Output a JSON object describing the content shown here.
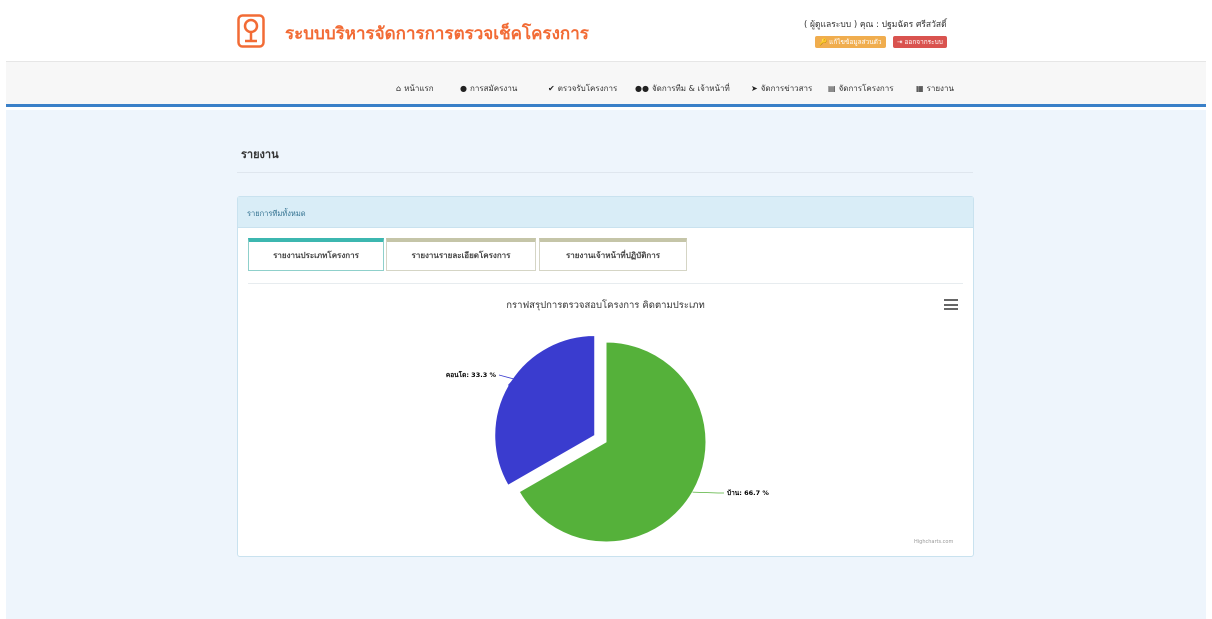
{
  "header": {
    "app_title": "ระบบบริหารจัดการการตรวจเช็คโครงการ",
    "user_line": "( ผู้ดูแลระบบ ) คุณ : ปฐมฉัตร ศรีสวัสดิ์",
    "profile_button": "🔑 แก้ไขข้อมูลส่วนตัว",
    "logout_button": "⇥ ออกจากระบบ"
  },
  "nav": {
    "items": [
      {
        "icon": "home-icon",
        "glyph": "⌂",
        "label": "หน้าแรก"
      },
      {
        "icon": "user-icon",
        "glyph": "👤",
        "label": "การสมัครงาน"
      },
      {
        "icon": "check-icon",
        "glyph": "✔",
        "label": "ตรวจรับโครงการ"
      },
      {
        "icon": "users-icon",
        "glyph": "👥",
        "label": "จัดการทีม & เจ้าหน้าที่"
      },
      {
        "icon": "send-icon",
        "glyph": "➤",
        "label": "จัดการข่าวสาร"
      },
      {
        "icon": "file-icon",
        "glyph": "▤",
        "label": "จัดการโครงการ"
      },
      {
        "icon": "chart-icon",
        "glyph": "▦",
        "label": "รายงาน"
      }
    ]
  },
  "page": {
    "title": "รายงาน",
    "panel_heading": "รายการทีมทั้งหมด"
  },
  "tabs": [
    {
      "label": "รายงานประเภทโครงการ",
      "active": true
    },
    {
      "label": "รายงานรายละเอียดโครงการ",
      "active": false
    },
    {
      "label": "รายงานเจ้าหน้าที่ปฏิบัติการ",
      "active": false
    }
  ],
  "chart_data": {
    "type": "pie",
    "title": "กราฟสรุปการตรวจสอบโครงการ คิดตามประเภท",
    "slices": [
      {
        "name": "บ้าน",
        "value": 66.7,
        "label": "บ้าน: 66.7 %",
        "color": "#55b13a"
      },
      {
        "name": "คอนโด",
        "value": 33.3,
        "label": "คอนโด: 33.3 %",
        "color": "#3a3ccf",
        "sliced": true
      }
    ],
    "credits": "Highcharts.com"
  },
  "colors": {
    "brand": "#f26b35",
    "accent_blue": "#3a80c8",
    "warning": "#f0ad4e",
    "danger": "#d9534f"
  }
}
